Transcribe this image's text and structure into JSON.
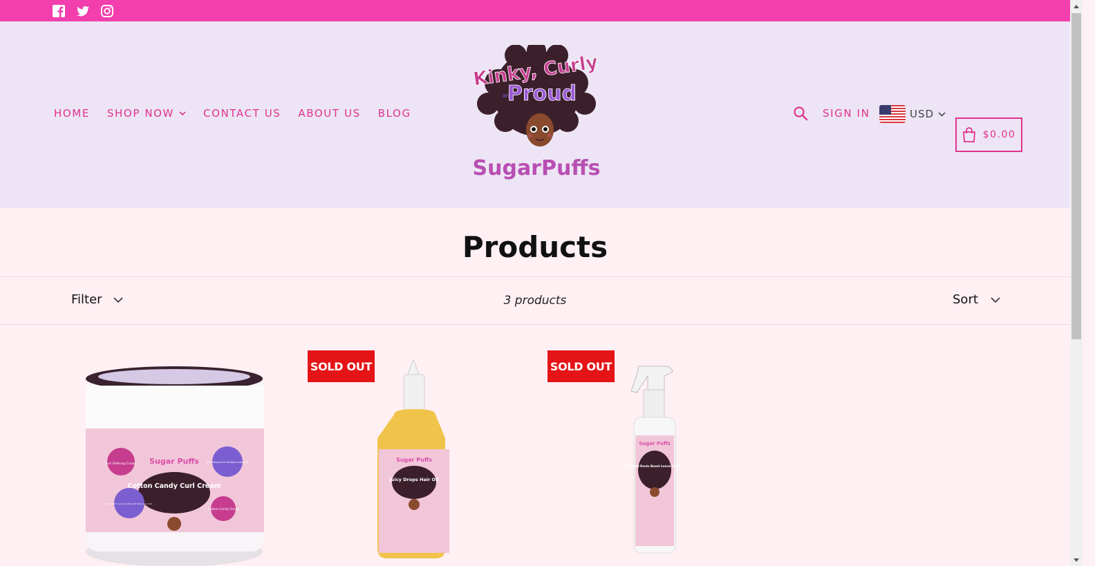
{
  "topbar": {
    "social": [
      "facebook-icon",
      "twitter-icon",
      "instagram-icon"
    ],
    "color": "#f23fad"
  },
  "nav": {
    "items": [
      {
        "label": "HOME"
      },
      {
        "label": "SHOP NOW"
      },
      {
        "label": "CONTACT US"
      },
      {
        "label": "ABOUT US"
      },
      {
        "label": "BLOG"
      }
    ]
  },
  "logo": {
    "line1": "Kinky, Curly",
    "and": "and",
    "line2": "Proud",
    "brand": "SugarPuffs"
  },
  "header_right": {
    "signin": "SIGN IN",
    "currency": "USD",
    "cart_total": "$0.00"
  },
  "page": {
    "title": "Products"
  },
  "toolbar": {
    "filter": "Filter",
    "count": "3 products",
    "sort": "Sort"
  },
  "products": [
    {
      "brand": "Sugar Puffs",
      "name": "Cotton Candy Curl Cream",
      "sold_out": false,
      "tags": [
        "Curl Defining Cream",
        "with Flaxseed Oil and Black Castor Oil",
        "Made with Love Just for Kids with Kinky Curly Coils",
        "Cotton Candy Scent"
      ]
    },
    {
      "brand": "Sugar Puffs",
      "name": "Juicy Drops Hair Oil",
      "sold_out": true,
      "badge": "SOLD OUT"
    },
    {
      "brand": "Sugar Puffs",
      "name": "Twisted Roots Boost-Leave in Mist",
      "sold_out": true,
      "badge": "SOLD OUT"
    }
  ],
  "colors": {
    "accent": "#e0328d",
    "header_bg": "#ede5f5",
    "page_bg": "#fff0f3",
    "badge": "#e51417"
  }
}
